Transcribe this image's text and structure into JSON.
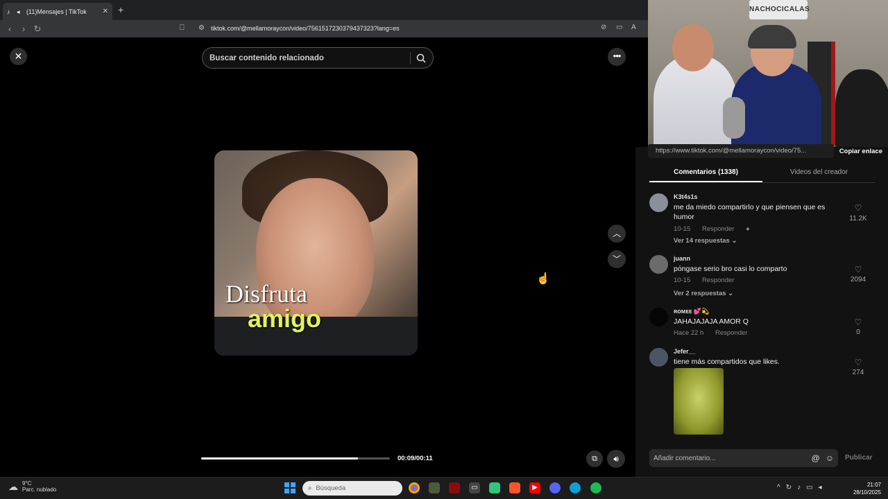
{
  "browser": {
    "tab_title": "(11)Mensajes | TikTok",
    "new_tab": "+",
    "url": "tiktok.com/@mellamoraycon/video/7561517230379437323?lang=es"
  },
  "player": {
    "search_placeholder": "Buscar contenido relacionado",
    "caption_line1": "Disfruta",
    "caption_line2": "amigo",
    "time": "00:09/00:11",
    "progress": 0.83
  },
  "stream": {
    "sign_text": "NACHOCICALAS"
  },
  "panel": {
    "link_url": "https://www.tiktok.com/@mellamoraycon/video/75...",
    "copy_link": "Copiar enlace",
    "tab_comments": "Comentarios (1338)",
    "tab_videos": "Videos del creador",
    "reply_label": "Responder",
    "comments": [
      {
        "user": "K3t4s1s",
        "text": "me da miedo compartirlo y que piensen que es humor",
        "date": "10-15",
        "replies": "Ver 14 respuestas",
        "likes": "11.2K",
        "avatar_color": "#8a8f99"
      },
      {
        "user": "juann",
        "text": "pόngase serio bro casi lo comparto",
        "date": "10-15",
        "replies": "Ver 2 respuestas",
        "likes": "2094",
        "avatar_color": "#6b6b6b"
      },
      {
        "user": "ʀᴏᴍᴇᴇ 💕💫",
        "text": "JAHAJAJAJA AMOR Q",
        "date": "Hace 22 h",
        "replies": "",
        "likes": "0",
        "avatar_color": "#050505"
      },
      {
        "user": "Jefer__",
        "text": "tiene más compartidos que likes.",
        "date": "",
        "replies": "",
        "likes": "274",
        "avatar_color": "#4b5663"
      }
    ],
    "add_comment_placeholder": "Añadir comentario...",
    "publish": "Publicar"
  },
  "taskbar": {
    "temp": "9°C",
    "weather": "Parc. nublado",
    "search": "Búsqueda",
    "time": "21:07",
    "date": "28/10/2025"
  },
  "colors": {
    "caption_accent": "#e2f25c",
    "background": "#000000",
    "panel": "#121212"
  }
}
